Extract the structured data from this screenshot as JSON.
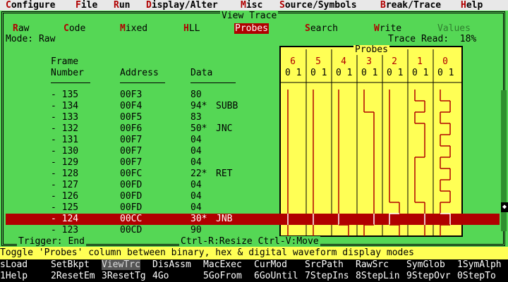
{
  "menubar": [
    {
      "hot": "C",
      "rest": "onfigure"
    },
    {
      "hot": "F",
      "rest": "ile"
    },
    {
      "hot": "R",
      "rest": "un"
    },
    {
      "hot": "D",
      "rest": "isplay/Alter"
    },
    {
      "hot": "M",
      "rest": "isc"
    },
    {
      "hot": "S",
      "rest": "ource/Symbols"
    },
    {
      "hot": "B",
      "rest": "reak/Trace"
    },
    {
      "hot": "H",
      "rest": "elp"
    }
  ],
  "window_title": "View Trace",
  "tabs": [
    {
      "hot": "R",
      "rest": "aw"
    },
    {
      "hot": "C",
      "rest": "ode"
    },
    {
      "hot": "M",
      "rest": "ixed"
    },
    {
      "hot": "H",
      "rest": "LL"
    },
    {
      "hot": "",
      "rest": "Probes"
    },
    {
      "hot": "S",
      "rest": "earch"
    },
    {
      "hot": "W",
      "rest": "rite"
    },
    {
      "hot": "",
      "rest": "Values"
    }
  ],
  "mode_text": "Mode: Raw",
  "trace_read_text": "Trace Read:  18%",
  "columns": {
    "frame_line1": "Frame",
    "frame_line2": "Number",
    "address": "Address",
    "data": "Data"
  },
  "probes_title": "Probes",
  "probe_numbers": [
    "6",
    "5",
    "4",
    "3",
    "2",
    "1",
    "0"
  ],
  "probe_bits": "0 1",
  "rows": [
    {
      "frame": "-  135",
      "address": "00F3",
      "data": "80",
      "mnemonic": ""
    },
    {
      "frame": "-  134",
      "address": "00F4",
      "data": "94*",
      "mnemonic": "SUBB"
    },
    {
      "frame": "-  133",
      "address": "00F5",
      "data": "83",
      "mnemonic": ""
    },
    {
      "frame": "-  132",
      "address": "00F6",
      "data": "50*",
      "mnemonic": "JNC"
    },
    {
      "frame": "-  131",
      "address": "00F7",
      "data": "04",
      "mnemonic": ""
    },
    {
      "frame": "-  130",
      "address": "00F7",
      "data": "04",
      "mnemonic": ""
    },
    {
      "frame": "-  129",
      "address": "00F7",
      "data": "04",
      "mnemonic": ""
    },
    {
      "frame": "-  128",
      "address": "00FC",
      "data": "22*",
      "mnemonic": "RET"
    },
    {
      "frame": "-  127",
      "address": "00FD",
      "data": "04",
      "mnemonic": ""
    },
    {
      "frame": "-  126",
      "address": "00FD",
      "data": "04",
      "mnemonic": ""
    },
    {
      "frame": "-  125",
      "address": "00FD",
      "data": "04",
      "mnemonic": ""
    },
    {
      "frame": "-  124",
      "address": "00CC",
      "data": "30*",
      "mnemonic": "JNB"
    },
    {
      "frame": "-  123",
      "address": "00CD",
      "data": "90",
      "mnemonic": ""
    }
  ],
  "selected_row_index": 11,
  "trigger_text": "Trigger: End",
  "hint_text": "Ctrl-R:Resize Ctrl-V:Move",
  "status_message": "Toggle 'Probes' column between binary, hex & digital waveform display modes",
  "fkeys_row1": [
    {
      "key": "s",
      "label": "Load"
    },
    {
      "key": " ",
      "label": "SetBkpt"
    },
    {
      "key": " ",
      "label": "ViewTrc"
    },
    {
      "key": " ",
      "label": "DisAssm"
    },
    {
      "key": " ",
      "label": "MacExec"
    },
    {
      "key": " ",
      "label": "CurMod"
    },
    {
      "key": " ",
      "label": "SrcPath"
    },
    {
      "key": " ",
      "label": "RawSrc"
    },
    {
      "key": " ",
      "label": "SymGlob"
    },
    {
      "key": "1",
      "label": "SymAlph"
    }
  ],
  "fkeys_row2": [
    {
      "key": "1",
      "label": "Help"
    },
    {
      "key": "2",
      "label": "ResetEm"
    },
    {
      "key": "3",
      "label": "ResetTg"
    },
    {
      "key": "4",
      "label": "Go"
    },
    {
      "key": "5",
      "label": "GoFrom"
    },
    {
      "key": "6",
      "label": "GoUntil"
    },
    {
      "key": "7",
      "label": "StepIns"
    },
    {
      "key": "8",
      "label": "StepLin"
    },
    {
      "key": "9",
      "label": "StepOvr"
    },
    {
      "key": "0",
      "label": "StepTo"
    }
  ],
  "colors": {
    "accent": "#b00000",
    "bg": "#55d755",
    "probe_bg": "#ffff55"
  }
}
